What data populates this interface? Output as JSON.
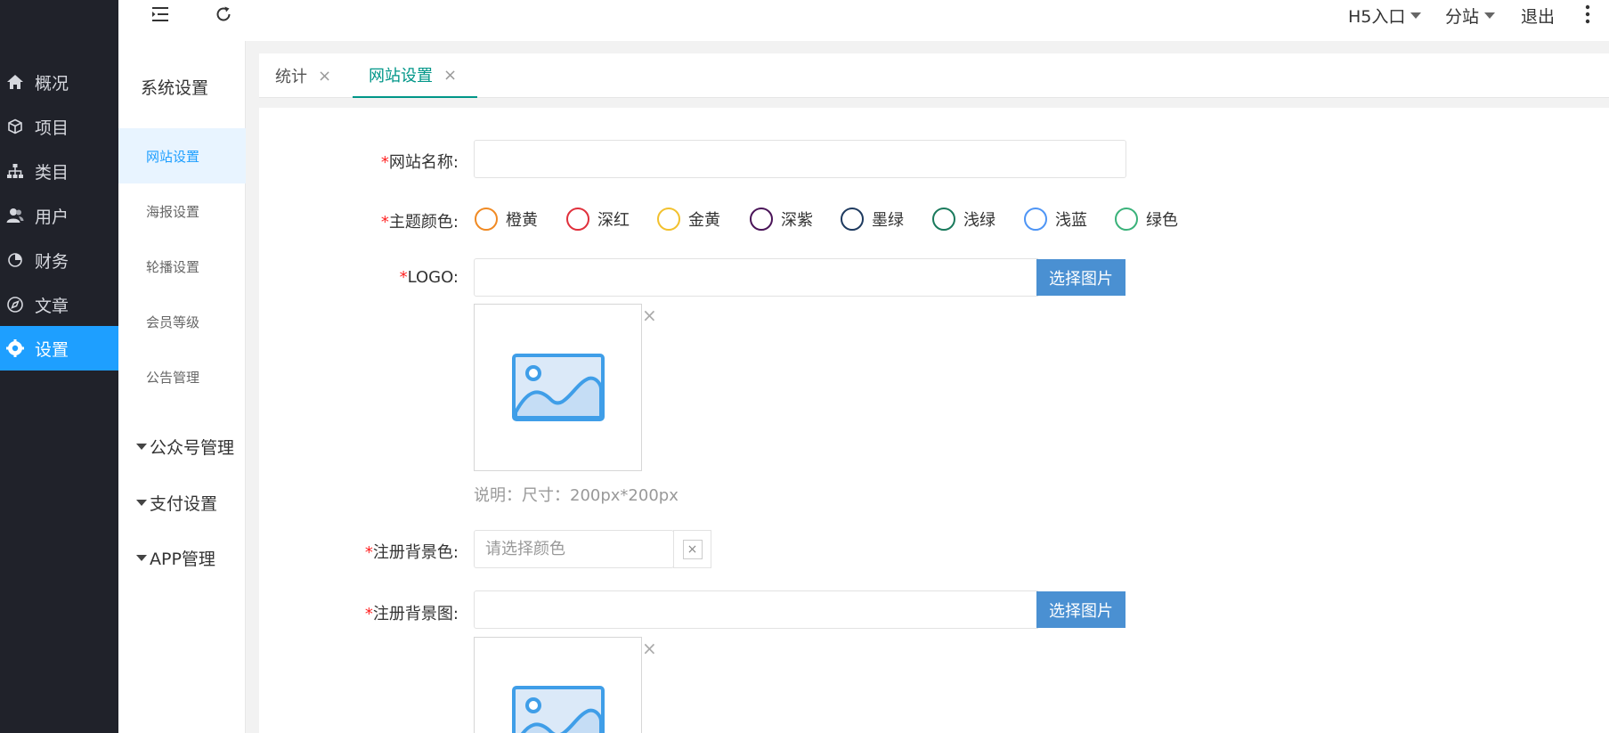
{
  "sidebar": {
    "items": [
      {
        "label": "概况",
        "icon": "home-icon"
      },
      {
        "label": "项目",
        "icon": "cube-icon"
      },
      {
        "label": "类目",
        "icon": "sitemap-icon"
      },
      {
        "label": "用户",
        "icon": "users-icon"
      },
      {
        "label": "财务",
        "icon": "pie-icon"
      },
      {
        "label": "文章",
        "icon": "compass-icon"
      },
      {
        "label": "设置",
        "icon": "gear-icon"
      }
    ],
    "active_color": "#1e9fff",
    "bg_color": "#20222a"
  },
  "header": {
    "menu_icon": "menu-fold-icon",
    "refresh_icon": "refresh-icon",
    "h5_label": "H5入口",
    "branch_label": "分站",
    "logout_label": "退出",
    "more_icon": "more-vertical-icon"
  },
  "subnav": {
    "title": "系统设置",
    "items": [
      "网站设置",
      "海报设置",
      "轮播设置",
      "会员等级",
      "公告管理"
    ],
    "groups": [
      "公众号管理",
      "支付设置",
      "APP管理"
    ]
  },
  "tabs": [
    {
      "label": "统计",
      "close": "×"
    },
    {
      "label": "网站设置",
      "close": "×"
    }
  ],
  "form": {
    "required_mark": "*",
    "site_name_label": "网站名称:",
    "site_name_value": "",
    "theme_label": "主题颜色:",
    "themes": [
      {
        "label": "橙黄",
        "color": "#f08a24"
      },
      {
        "label": "深红",
        "color": "#e0303c"
      },
      {
        "label": "金黄",
        "color": "#f2c12e"
      },
      {
        "label": "深紫",
        "color": "#4a1458"
      },
      {
        "label": "墨绿",
        "color": "#1e3a5f"
      },
      {
        "label": "浅绿",
        "color": "#1a7a5c"
      },
      {
        "label": "浅蓝",
        "color": "#4e95f5"
      },
      {
        "label": "绿色",
        "color": "#3ab27a"
      }
    ],
    "logo_label": "LOGO:",
    "logo_value": "",
    "select_image_button": "选择图片",
    "remove": "×",
    "logo_hint": "说明：尺寸：200px*200px",
    "reg_bg_color_label": "注册背景色:",
    "reg_bg_color_placeholder": "请选择颜色",
    "clear": "×",
    "reg_bg_image_label": "注册背景图:",
    "reg_bg_image_value": "",
    "image_icon": "image-placeholder-icon",
    "button_color": "#4a90d2"
  }
}
